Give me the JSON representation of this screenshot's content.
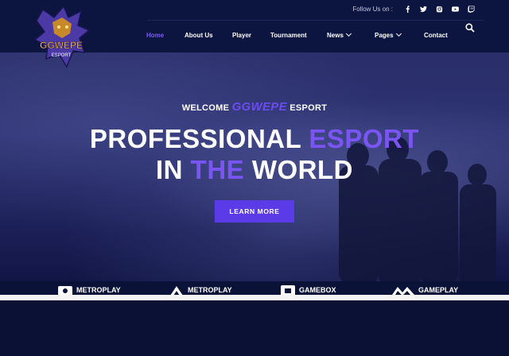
{
  "brand": {
    "logo_text": "GGWEPE",
    "logo_subtext": "ESPORT"
  },
  "header": {
    "follow_label": "Follow Us on :",
    "socials": [
      "facebook-icon",
      "twitter-icon",
      "instagram-icon",
      "youtube-icon",
      "twitch-icon"
    ],
    "nav": [
      {
        "label": "Home",
        "active": true
      },
      {
        "label": "About Us"
      },
      {
        "label": "Player"
      },
      {
        "label": "Tournament"
      },
      {
        "label": "News",
        "dropdown": true
      },
      {
        "label": "Pages",
        "dropdown": true
      },
      {
        "label": "Contact"
      }
    ]
  },
  "hero": {
    "welcome_prefix": "WELCOME",
    "welcome_brand": "GGWEPE",
    "welcome_suffix": "ESPORT",
    "line1_a": "PROFESSIONAL",
    "line1_b": "ESPORT",
    "line2_a": "IN",
    "line2_b": "THE",
    "line2_c": "WORLD",
    "cta": "LEARN MORE"
  },
  "partners": [
    "METROPLAY",
    "METROPLAY",
    "GAMEBOX",
    "GAMEPLAY"
  ],
  "colors": {
    "accent": "#6b4cf0",
    "button": "#5b3be8",
    "navy": "#0b1540"
  }
}
